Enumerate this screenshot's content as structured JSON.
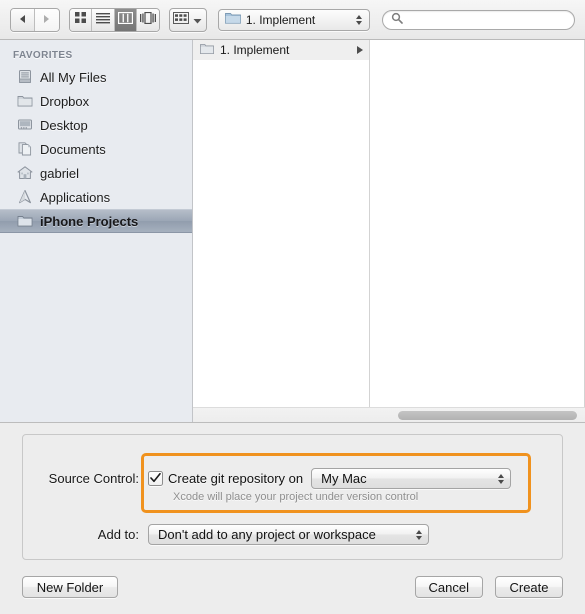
{
  "toolbar": {
    "nav": {
      "back_icon": "back-triangle-icon",
      "forward_icon": "forward-triangle-icon"
    },
    "view_modes": [
      {
        "name": "icon-view",
        "icon": "grid-icon",
        "selected": false
      },
      {
        "name": "list-view",
        "icon": "list-lines-icon",
        "selected": false
      },
      {
        "name": "column-view",
        "icon": "columns-icon",
        "selected": true
      },
      {
        "name": "coverflow-view",
        "icon": "coverflow-icon",
        "selected": false
      }
    ],
    "arrange": {
      "icon": "arrange-grid-icon",
      "chevron": "chevron-down-icon"
    },
    "path_popup": {
      "icon": "blue-folder-icon",
      "label": "1. Implement"
    },
    "search": {
      "icon": "search-icon",
      "value": "",
      "placeholder": ""
    }
  },
  "sidebar": {
    "header": "FAVORITES",
    "items": [
      {
        "label": "All My Files",
        "icon": "all-my-files-icon",
        "selected": false
      },
      {
        "label": "Dropbox",
        "icon": "folder-icon",
        "selected": false
      },
      {
        "label": "Desktop",
        "icon": "desktop-icon",
        "selected": false
      },
      {
        "label": "Documents",
        "icon": "documents-icon",
        "selected": false
      },
      {
        "label": "gabriel",
        "icon": "home-icon",
        "selected": false
      },
      {
        "label": "Applications",
        "icon": "applications-icon",
        "selected": false
      },
      {
        "label": "iPhone Projects",
        "icon": "folder-icon",
        "selected": true
      }
    ]
  },
  "browser": {
    "column1": {
      "rows": [
        {
          "label": "1. Implement",
          "icon": "folder-icon",
          "has_disclosure": true
        }
      ]
    }
  },
  "accessory": {
    "source_control": {
      "label": "Source Control:",
      "checkbox_label": "Create git repository on",
      "checkbox_checked": true,
      "check_glyph": "checkmark-icon",
      "location_value": "My Mac",
      "help_text": "Xcode will place your project under version control",
      "focus_ring_color": "#f0921e"
    },
    "add_to": {
      "label": "Add to:",
      "value": "Don't add to any project or workspace"
    }
  },
  "footer": {
    "new_folder_label": "New Folder",
    "cancel_label": "Cancel",
    "create_label": "Create"
  }
}
